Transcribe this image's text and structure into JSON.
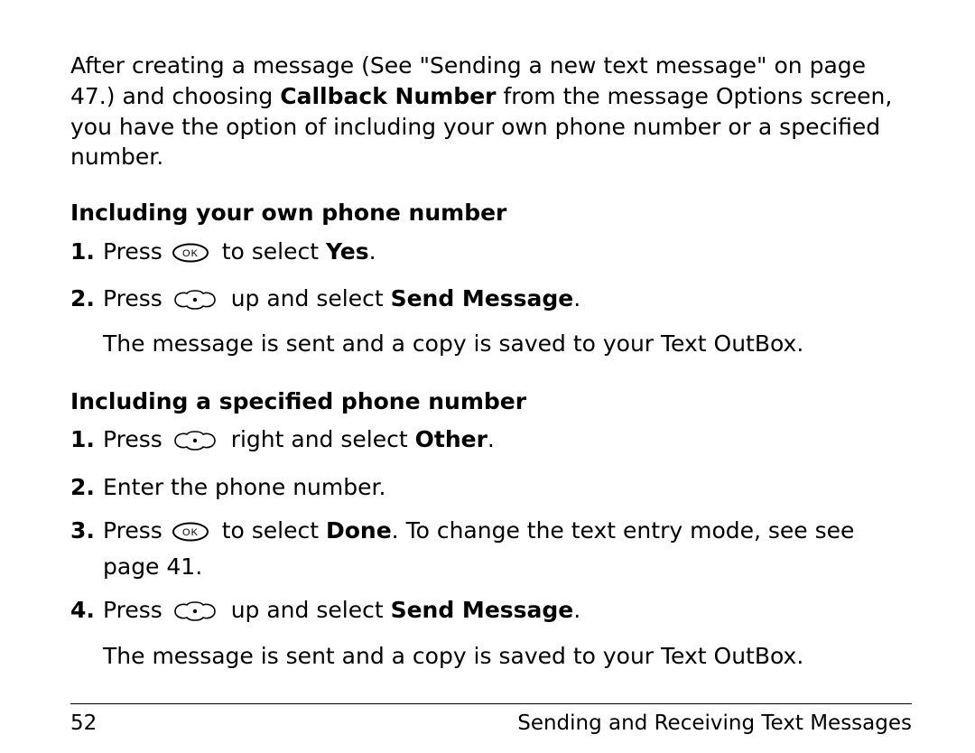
{
  "intro": {
    "part1": "After creating a message (See \"Sending a new text message\" on page 47.) and choosing ",
    "bold1": "Callback Number",
    "part2": " from the message Options screen, you have the option of including your own phone number or a specified number."
  },
  "section1": {
    "heading": "Including your own phone number",
    "steps": {
      "n1": "1.",
      "s1a": "Press ",
      "s1b": " to select ",
      "s1bold": "Yes",
      "s1c": ".",
      "n2": "2.",
      "s2a": "Press ",
      "s2b": " up and select ",
      "s2bold": "Send Message",
      "s2c": ".",
      "s2cont": "The message is sent and a copy is saved to your Text OutBox."
    }
  },
  "section2": {
    "heading": "Including a specified phone number",
    "steps": {
      "n1": "1.",
      "s1a": "Press ",
      "s1b": " right and select ",
      "s1bold": "Other",
      "s1c": ".",
      "n2": "2.",
      "s2": "Enter the phone number.",
      "n3": "3.",
      "s3a": "Press ",
      "s3b": " to select ",
      "s3bold": "Done",
      "s3c": ". To change the text entry mode, see see page 41.",
      "n4": "4.",
      "s4a": "Press ",
      "s4b": " up and select ",
      "s4bold": "Send Message",
      "s4c": ".",
      "s4cont": "The message is sent and a copy is saved to your Text OutBox."
    }
  },
  "footer": {
    "page": "52",
    "title": "Sending and Receiving Text Messages"
  }
}
